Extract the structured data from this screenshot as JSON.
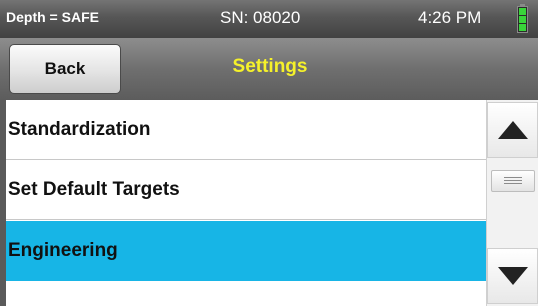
{
  "status_bar": {
    "depth_status": "Depth = SAFE",
    "serial": "SN: 08020",
    "time": "4:26 PM",
    "battery_icon": "battery-full-icon",
    "battery_color": "#39d53a"
  },
  "nav_bar": {
    "back_label": "Back",
    "title": "Settings",
    "title_color": "#f5f12a"
  },
  "menu": {
    "items": [
      {
        "label": "Standardization",
        "selected": false
      },
      {
        "label": "Set Default Targets",
        "selected": false
      },
      {
        "label": "Engineering",
        "selected": true
      }
    ],
    "selected_color": "#17b5e6"
  },
  "scrollbar": {
    "up_icon": "triangle-up-icon",
    "down_icon": "triangle-down-icon",
    "thumb_icon": "grip-lines-icon"
  }
}
